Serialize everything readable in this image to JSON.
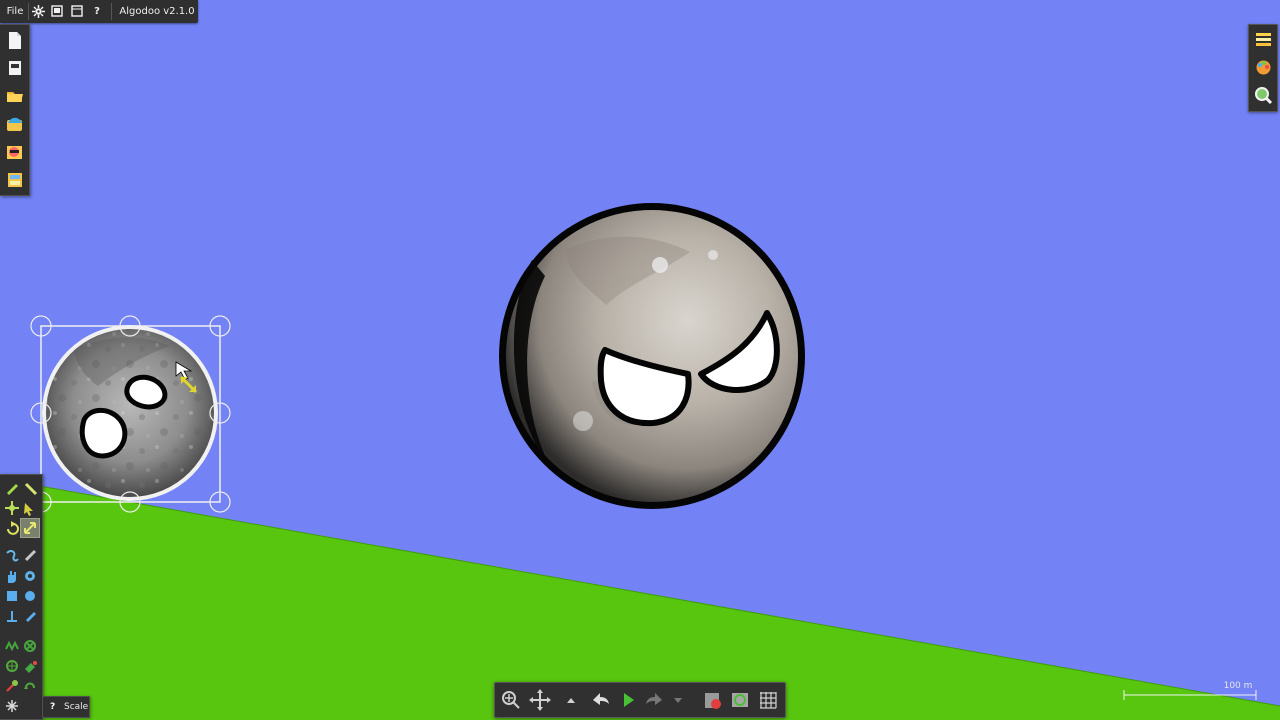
{
  "menu": {
    "file_label": "File",
    "app_title": "Algodoo v2.1.0"
  },
  "colors": {
    "sky": "#7383f5",
    "ground": "#58c60f",
    "toolbar": "#303030",
    "selection": "#f0f0f0"
  },
  "left_toolbar": {
    "items": [
      "new-scene-icon",
      "scene-window-icon",
      "open-folder-icon",
      "load-phunlet-icon",
      "photo-image-icon",
      "scene-library-icon"
    ]
  },
  "right_toolbar": {
    "items": [
      "layers-icon",
      "palette-icon",
      "search-icon"
    ]
  },
  "tools": {
    "items": [
      "sketch-tool-icon",
      "brush-tool-icon",
      "move-tool-icon",
      "drag-tool-icon",
      "rotate-tool-icon",
      "scale-tool-icon",
      "rope-tool-icon",
      "knife-tool-icon",
      "hand-tool-icon",
      "gear-tool-icon",
      "box-tool-icon",
      "circle-tool-icon",
      "plane-tool-icon",
      "pen-tool-icon",
      "spring-tool-icon",
      "fixate-tool-icon",
      "axle-tool-icon",
      "thruster-tool-icon",
      "laser-tool-icon",
      "chain-tool-icon",
      "tracer-tool-icon"
    ],
    "help_label": "Scale",
    "help_mark": "?"
  },
  "bottom_bar": {
    "items": [
      "zoom-icon",
      "pan-icon",
      "up-arrow-icon",
      "undo-icon",
      "play-icon",
      "redo-icon",
      "down-arrow-icon",
      "erase-scene-icon",
      "camera-follow-icon",
      "grid-icon"
    ]
  },
  "scale": {
    "label": "100 m"
  }
}
